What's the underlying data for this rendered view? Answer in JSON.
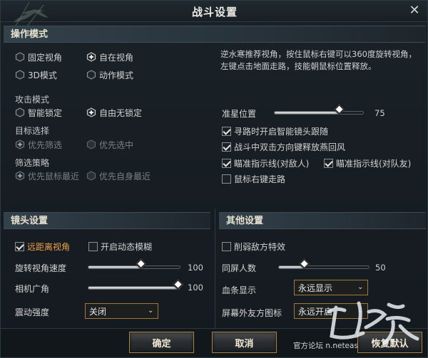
{
  "window": {
    "title": "战斗设置",
    "close_glyph": "✕"
  },
  "operation": {
    "header": "操作模式",
    "modes": [
      {
        "label": "固定视角",
        "selected": false
      },
      {
        "label": "自在视角",
        "selected": true
      },
      {
        "label": "3D模式",
        "selected": false
      },
      {
        "label": "动作模式",
        "selected": false
      }
    ],
    "description": "逆水寒推荐视角，按住鼠标右键可以360度旋转视角，左键点击地面走路，技能朝鼠标位置释放。"
  },
  "attack": {
    "label": "攻击模式",
    "options": [
      {
        "label": "智能锁定",
        "selected": false
      },
      {
        "label": "自由无锁定",
        "selected": true
      }
    ]
  },
  "target": {
    "label": "目标选择",
    "options": [
      {
        "label": "优先筛选",
        "selected": true,
        "disabled": true
      },
      {
        "label": "优先选中",
        "selected": false,
        "disabled": true
      }
    ]
  },
  "filter": {
    "label": "筛选策略",
    "options": [
      {
        "label": "优先鼠标最近",
        "selected": true,
        "disabled": true
      },
      {
        "label": "优先自身最近",
        "selected": false,
        "disabled": true
      }
    ]
  },
  "crosshair": {
    "label": "准星位置",
    "value": "75",
    "fraction": 0.75
  },
  "checks": [
    {
      "label": "寻路时开启智能镜头跟随",
      "checked": true
    },
    {
      "label": "战斗中双击方向键释放燕回风",
      "checked": true
    },
    {
      "label": "瞄准指示线(对敌人)",
      "checked": true
    },
    {
      "label": "瞄准指示线(对队友)",
      "checked": true
    },
    {
      "label": "鼠标右键走路",
      "checked": false
    }
  ],
  "camera": {
    "header": "镜头设置",
    "far_view": {
      "label": "远距离视角",
      "checked": true
    },
    "motion_blur": {
      "label": "开启动态模糊",
      "checked": false
    },
    "rotate_speed": {
      "label": "旋转视角速度",
      "value": "100",
      "fraction": 0.59
    },
    "fov": {
      "label": "相机广角",
      "value": "100",
      "fraction": 1.0
    },
    "shake": {
      "label": "震动强度",
      "selected": "关闭"
    }
  },
  "other": {
    "header": "其他设置",
    "weaken_enemy": {
      "label": "削弱敌方特效",
      "checked": false
    },
    "same_screen": {
      "label": "同屏人数",
      "value": "50",
      "fraction": 0.3
    },
    "health_bar": {
      "label": "血条显示",
      "selected": "永远显示"
    },
    "offscreen_icon": {
      "label": "屏幕外友方图标",
      "selected": "永远开启"
    }
  },
  "footer": {
    "confirm": "确定",
    "cancel": "取消",
    "restore": "恢复默认",
    "site": "官方论坛 n.netease.com",
    "logo_text": "逆水寒"
  },
  "colors": {
    "accent_gold": "#a88444",
    "highlight_orange": "#f0a24a",
    "panel_header": "#33414b"
  }
}
